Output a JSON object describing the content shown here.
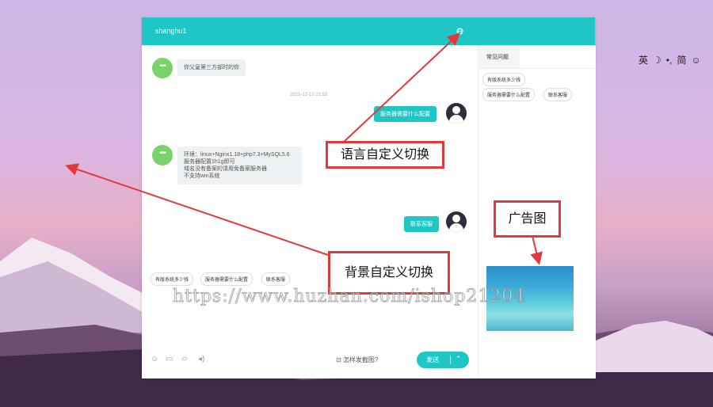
{
  "ime": {
    "items": [
      "英",
      "☽",
      "•,",
      "简",
      "☺"
    ]
  },
  "chat": {
    "title": "shanghu1",
    "messages": {
      "greeting": "你父皇第三方部时的你",
      "timestamp": "2021-12-10 21:53",
      "user_q1": "服务器需要什么配置",
      "env_lines": [
        "环境：linux+Nginx1.18+php7.3+MySQL5.6",
        "服务器配置1h1g即可",
        "域名没有备案的请用免备案服务器",
        "不支持win系统"
      ],
      "user_q2": "联系客服"
    },
    "quick_chips": [
      "有版系统多少钱",
      "服务器需要什么配置",
      "联系客服"
    ],
    "toolbar": {
      "screenshot_hint": "怎样发截图?",
      "send_label": "发送"
    }
  },
  "sidebar": {
    "tab_label": "常见问题",
    "chips": [
      "有版系统多少钱",
      "服务器需要什么配置",
      "联系客服"
    ]
  },
  "annotations": {
    "language": "语言自定义切换",
    "background": "背景自定义切换",
    "ad": "广告图"
  },
  "watermark": "https://www.huzhan.com/ishop21204",
  "colors": {
    "accent": "#1ec6c6",
    "annotation": "#e03a3a"
  }
}
